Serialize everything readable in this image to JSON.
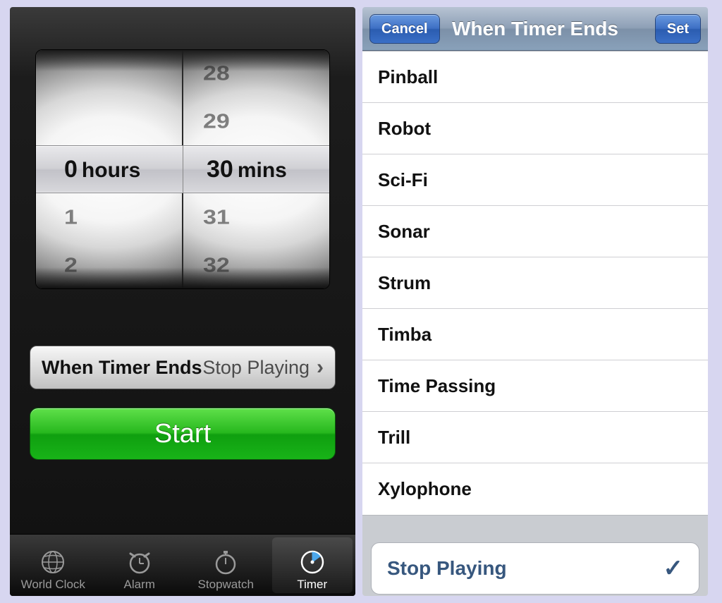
{
  "timer": {
    "picker": {
      "hours_values": [
        "",
        "",
        "0",
        "1",
        "2"
      ],
      "hours_selected": "0",
      "hours_unit": "hours",
      "mins_values": [
        "28",
        "29",
        "30",
        "31",
        "32"
      ],
      "mins_selected": "30",
      "mins_unit": "mins"
    },
    "when_ends": {
      "label": "When Timer Ends",
      "value": "Stop Playing"
    },
    "start_label": "Start",
    "tabs": {
      "world_clock": "World Clock",
      "alarm": "Alarm",
      "stopwatch": "Stopwatch",
      "timer": "Timer"
    }
  },
  "sound_picker": {
    "cancel": "Cancel",
    "title": "When Timer Ends",
    "set": "Set",
    "sounds": [
      "Pinball",
      "Robot",
      "Sci-Fi",
      "Sonar",
      "Strum",
      "Timba",
      "Time Passing",
      "Trill",
      "Xylophone"
    ],
    "stop_playing": "Stop Playing"
  }
}
